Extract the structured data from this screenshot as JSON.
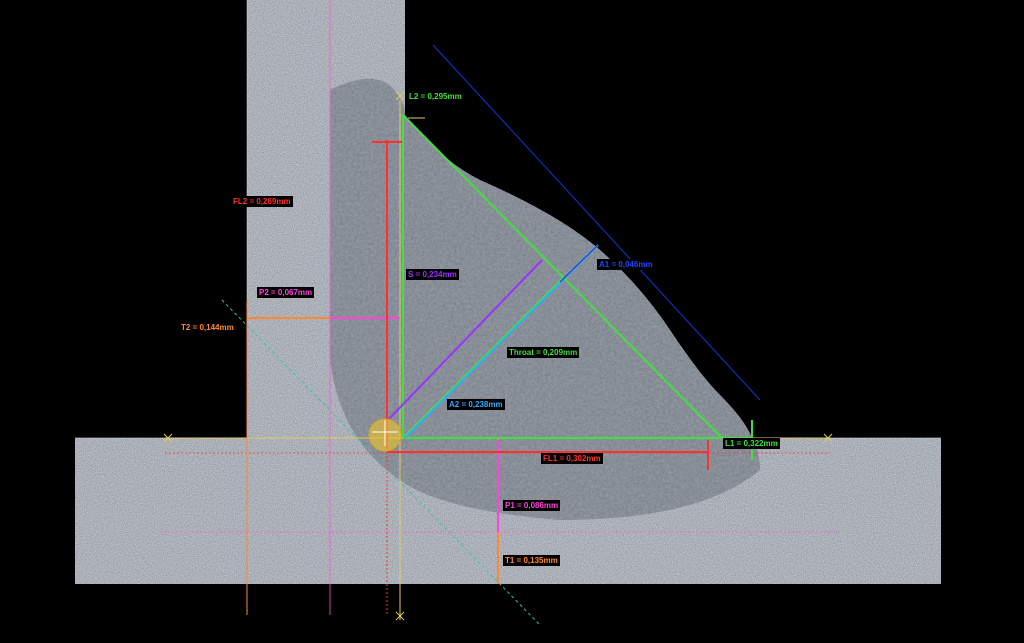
{
  "measurements": {
    "l2": {
      "text": "L2 = 0,295mm",
      "color": "#44dd44"
    },
    "fl2": {
      "text": "FL2 = 0,269mm",
      "color": "#ff3030"
    },
    "s": {
      "text": "S = 0,234mm",
      "color": "#9933ff"
    },
    "a1": {
      "text": "A1 = 0,046mm",
      "color": "#2244ff"
    },
    "p2": {
      "text": "P2 = 0,067mm",
      "color": "#ff44dd"
    },
    "t2": {
      "text": "T2 = 0,144mm",
      "color": "#ff8833"
    },
    "throat": {
      "text": "Throat = 0,209mm",
      "color": "#44dd44"
    },
    "a2": {
      "text": "A2 = 0,238mm",
      "color": "#33aaff"
    },
    "l1": {
      "text": "L1 = 0,322mm",
      "color": "#44dd44"
    },
    "fl1": {
      "text": "FL1 = 0,302mm",
      "color": "#ff3030"
    },
    "p1": {
      "text": "P1 = 0,086mm",
      "color": "#ff44dd"
    },
    "t1": {
      "text": "T1 = 0,135mm",
      "color": "#ff8833"
    }
  }
}
